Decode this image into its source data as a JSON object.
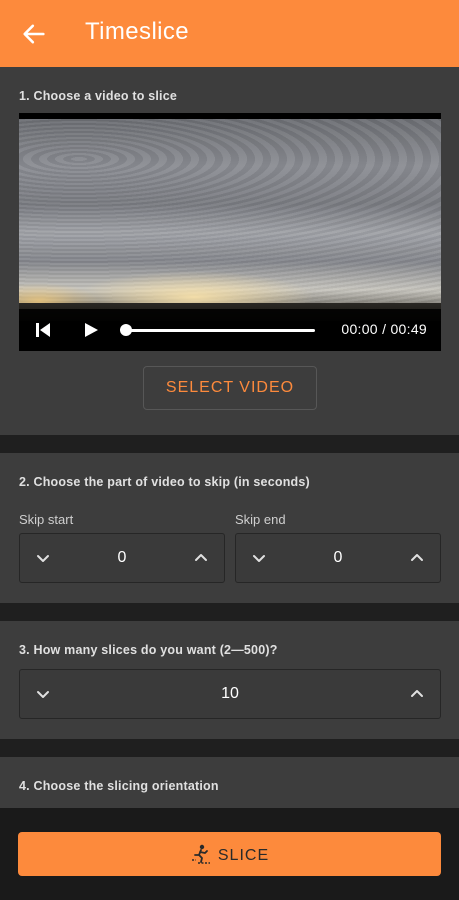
{
  "app_bar": {
    "title": "Timeslice",
    "back_icon": "arrow-left-icon",
    "color": "#fd8a3c"
  },
  "step1": {
    "label": "1. Choose a video to slice",
    "player": {
      "time": "00:00 / 00:49",
      "progress": 0,
      "icons": [
        "skip-back-icon",
        "play-icon"
      ]
    },
    "select_button": "SELECT VIDEO"
  },
  "step2": {
    "label": "2. Choose the part of video to skip (in seconds)",
    "skip_start": {
      "label": "Skip start",
      "value": "0"
    },
    "skip_end": {
      "label": "Skip end",
      "value": "0"
    }
  },
  "step3": {
    "label": "3. How many slices do you want (2—500)?",
    "value": "10"
  },
  "step4": {
    "label": "4. Choose the slicing orientation"
  },
  "slice_button": {
    "label": "SLICE",
    "icon": "slice-person-icon"
  }
}
